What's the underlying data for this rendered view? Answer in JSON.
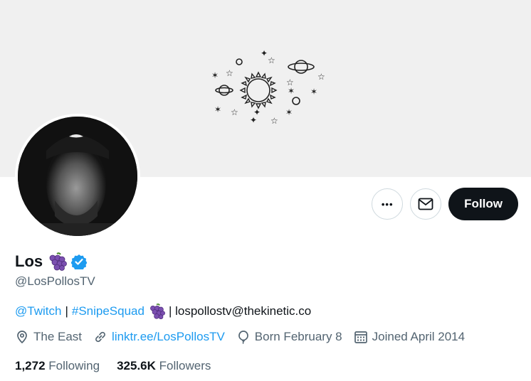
{
  "profile": {
    "name": "Los",
    "handle": "@LosPollosTV",
    "bio": {
      "twitch": "@Twitch",
      "sep1": "|",
      "hashtag": "#SnipeSquad",
      "sep2": "| lospollostv@thekinetic.co"
    },
    "location": "The East",
    "website": "linktr.ee/LosPollosTV",
    "birthday": "Born February 8",
    "joined": "Joined April 2014",
    "following_count": "1,272",
    "following_label": "Following",
    "followers_count": "325.6K",
    "followers_label": "Followers"
  },
  "actions": {
    "follow_label": "Follow",
    "more_label": "•••"
  },
  "colors": {
    "accent": "#1d9bf0",
    "secondary_text": "#536471",
    "banner": "#f0f0f0"
  }
}
